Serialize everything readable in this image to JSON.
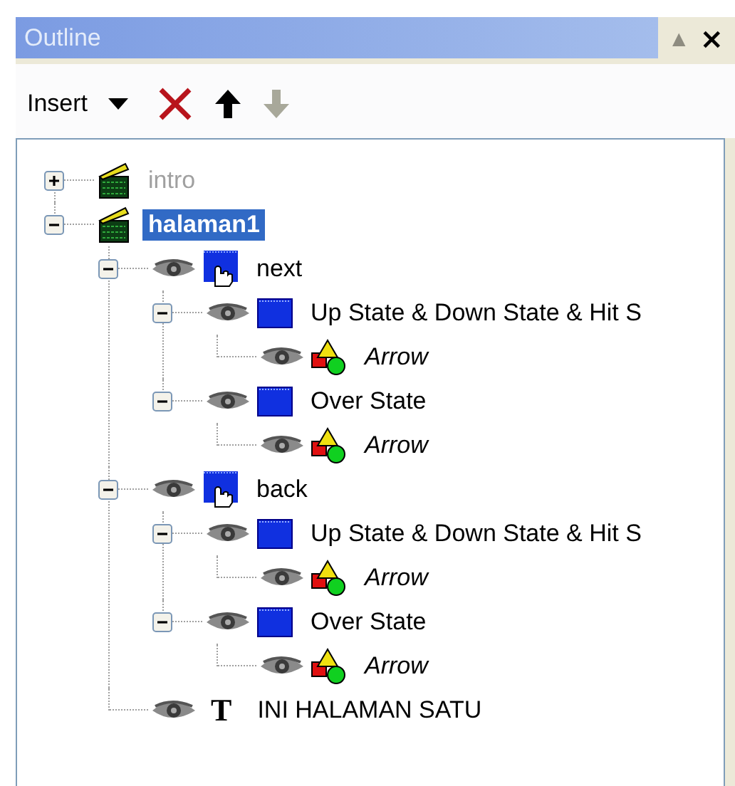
{
  "panel": {
    "title": "Outline",
    "title_buttons": [
      {
        "glyph": "▲",
        "disabled": true
      },
      {
        "glyph": "×",
        "disabled": false
      }
    ]
  },
  "toolbar": [
    {
      "kind": "dropdown",
      "label": "Insert",
      "disabled": false
    },
    {
      "kind": "delete",
      "disabled": false
    },
    {
      "kind": "move-up",
      "disabled": false
    },
    {
      "kind": "move-down",
      "disabled": true
    }
  ],
  "tree": [
    {
      "kind": "scene",
      "label": "intro",
      "expanded": false,
      "selected": false,
      "disabled": true
    },
    {
      "kind": "scene",
      "label": "halaman1",
      "expanded": true,
      "selected": true,
      "disabled": false,
      "children": [
        {
          "kind": "button",
          "label": "next",
          "expanded": true,
          "selected": false,
          "disabled": false,
          "children": [
            {
              "kind": "frame",
              "label": "Up State & Down State & Hit S",
              "expanded": true,
              "selected": false,
              "disabled": false,
              "children": [
                {
                  "kind": "shape",
                  "label": "Arrow",
                  "selected": false,
                  "disabled": false
                }
              ]
            },
            {
              "kind": "frame",
              "label": "Over State",
              "expanded": true,
              "selected": false,
              "disabled": false,
              "children": [
                {
                  "kind": "shape",
                  "label": "Arrow",
                  "selected": false,
                  "disabled": false
                }
              ]
            }
          ]
        },
        {
          "kind": "button",
          "label": "back",
          "expanded": true,
          "selected": false,
          "disabled": false,
          "children": [
            {
              "kind": "frame",
              "label": "Up State & Down State & Hit S",
              "expanded": true,
              "selected": false,
              "disabled": false,
              "children": [
                {
                  "kind": "shape",
                  "label": "Arrow",
                  "selected": false,
                  "disabled": false
                }
              ]
            },
            {
              "kind": "frame",
              "label": "Over State",
              "expanded": true,
              "selected": false,
              "disabled": false,
              "children": [
                {
                  "kind": "shape",
                  "label": "Arrow",
                  "selected": false,
                  "disabled": false
                }
              ]
            }
          ]
        },
        {
          "kind": "text",
          "glyph": "T",
          "label": "INI HALAMAN SATU",
          "selected": false,
          "disabled": false
        }
      ]
    }
  ]
}
